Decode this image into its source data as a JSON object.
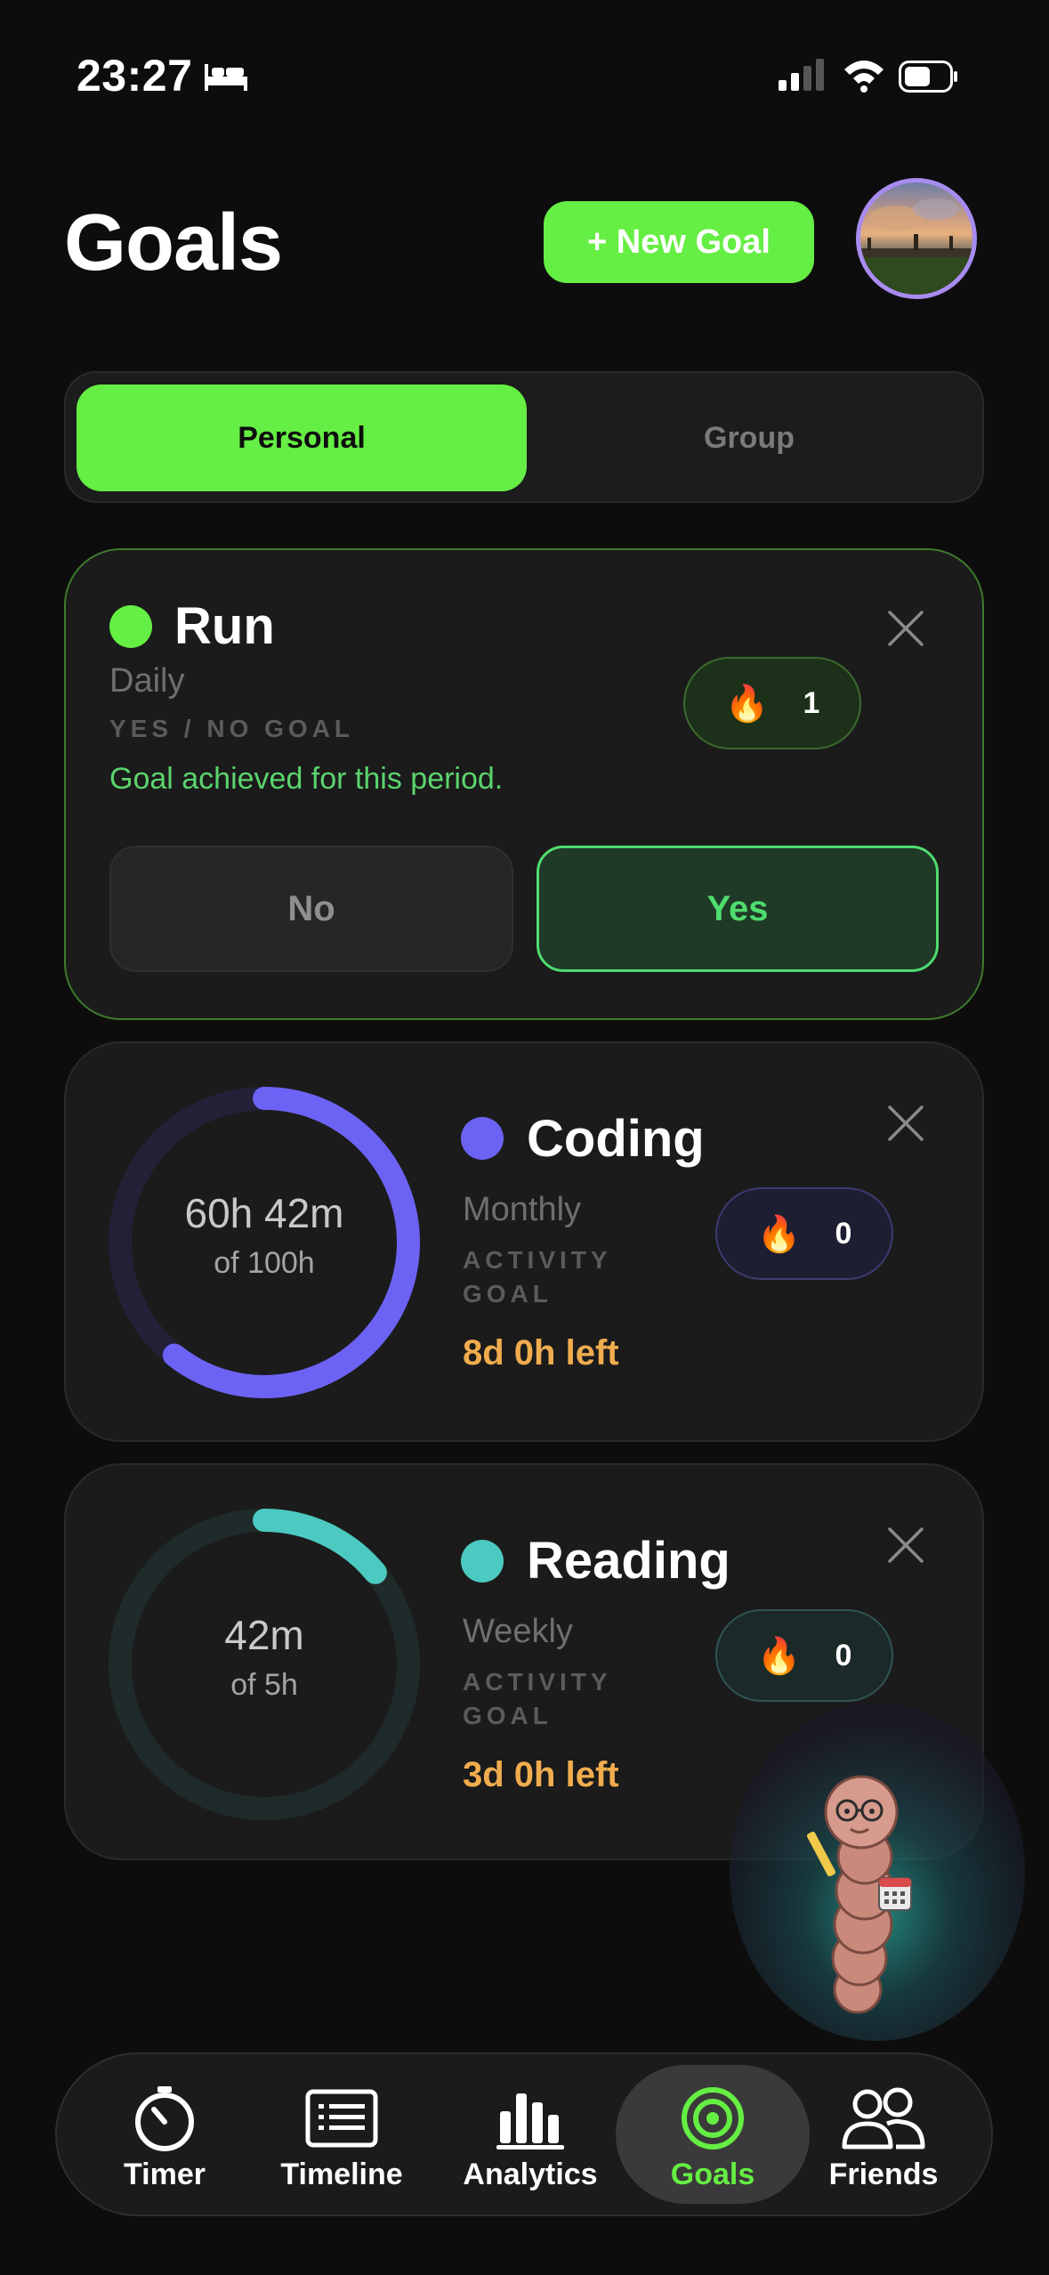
{
  "status_bar": {
    "time": "23:27"
  },
  "header": {
    "title": "Goals",
    "new_goal_label": "+ New Goal"
  },
  "segments": {
    "personal": "Personal",
    "group": "Group",
    "selected": "Personal"
  },
  "goals": [
    {
      "name": "Run",
      "period": "Daily",
      "type": "YES / NO GOAL",
      "status": "Goal achieved for this period.",
      "streak": "1",
      "color": "#65ee43",
      "no_label": "No",
      "yes_label": "Yes"
    },
    {
      "name": "Coding",
      "period": "Monthly",
      "type": "ACTIVITY GOAL",
      "progress": "60h 42m",
      "target": "of 100h",
      "progress_fraction": 0.607,
      "time_left": "8d 0h left",
      "streak": "0",
      "color": "#6c63f5"
    },
    {
      "name": "Reading",
      "period": "Weekly",
      "type": "ACTIVITY GOAL",
      "progress": "42m",
      "target": "of 5h",
      "progress_fraction": 0.14,
      "time_left": "3d 0h left",
      "streak": "0",
      "color": "#4cc9c1"
    }
  ],
  "tabs": [
    {
      "label": "Timer",
      "icon": "timer-icon"
    },
    {
      "label": "Timeline",
      "icon": "timeline-icon"
    },
    {
      "label": "Analytics",
      "icon": "analytics-icon"
    },
    {
      "label": "Goals",
      "icon": "goals-icon",
      "active": true
    },
    {
      "label": "Friends",
      "icon": "friends-icon"
    }
  ],
  "colors": {
    "accent": "#65ee43",
    "time_left": "#f0ac4e"
  }
}
